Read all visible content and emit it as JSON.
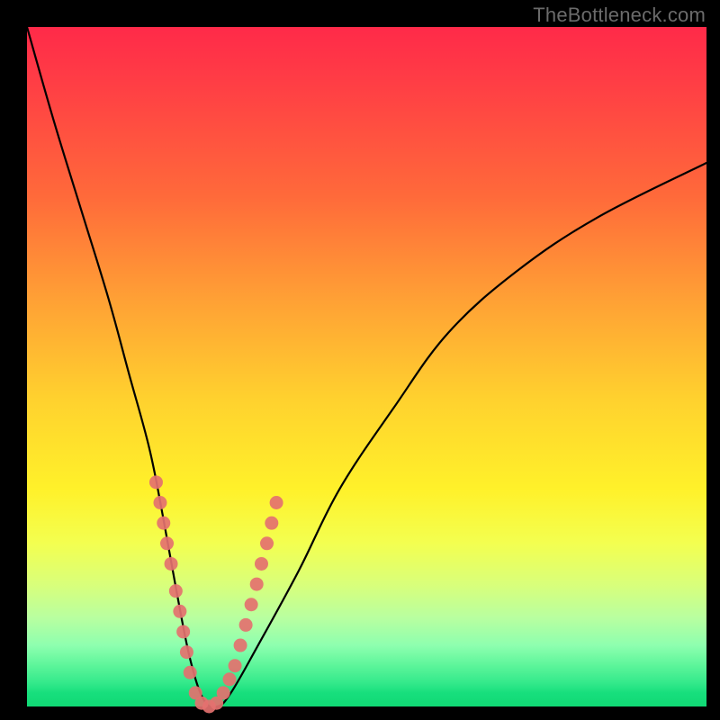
{
  "watermark": "TheBottleneck.com",
  "chart_data": {
    "type": "line",
    "title": "",
    "xlabel": "",
    "ylabel": "",
    "xlim": [
      0,
      100
    ],
    "ylim": [
      0,
      100
    ],
    "series": [
      {
        "name": "bottleneck-curve",
        "x": [
          0,
          4,
          8,
          12,
          15,
          18,
          20,
          22,
          24,
          26,
          28,
          30,
          34,
          40,
          46,
          54,
          62,
          72,
          84,
          100
        ],
        "y": [
          100,
          86,
          73,
          60,
          49,
          38,
          28,
          17,
          7,
          1,
          0,
          2,
          9,
          20,
          32,
          44,
          55,
          64,
          72,
          80
        ]
      }
    ],
    "markers": {
      "name": "highlight-dots",
      "color": "#e4716f",
      "points": [
        {
          "x": 19.0,
          "y": 33
        },
        {
          "x": 19.6,
          "y": 30
        },
        {
          "x": 20.1,
          "y": 27
        },
        {
          "x": 20.6,
          "y": 24
        },
        {
          "x": 21.2,
          "y": 21
        },
        {
          "x": 21.9,
          "y": 17
        },
        {
          "x": 22.5,
          "y": 14
        },
        {
          "x": 23.0,
          "y": 11
        },
        {
          "x": 23.5,
          "y": 8
        },
        {
          "x": 24.0,
          "y": 5
        },
        {
          "x": 24.8,
          "y": 2
        },
        {
          "x": 25.7,
          "y": 0.5
        },
        {
          "x": 26.8,
          "y": 0
        },
        {
          "x": 27.9,
          "y": 0.5
        },
        {
          "x": 28.9,
          "y": 2
        },
        {
          "x": 29.8,
          "y": 4
        },
        {
          "x": 30.6,
          "y": 6
        },
        {
          "x": 31.4,
          "y": 9
        },
        {
          "x": 32.2,
          "y": 12
        },
        {
          "x": 33.0,
          "y": 15
        },
        {
          "x": 33.8,
          "y": 18
        },
        {
          "x": 34.5,
          "y": 21
        },
        {
          "x": 35.3,
          "y": 24
        },
        {
          "x": 36.0,
          "y": 27
        },
        {
          "x": 36.7,
          "y": 30
        }
      ]
    }
  }
}
